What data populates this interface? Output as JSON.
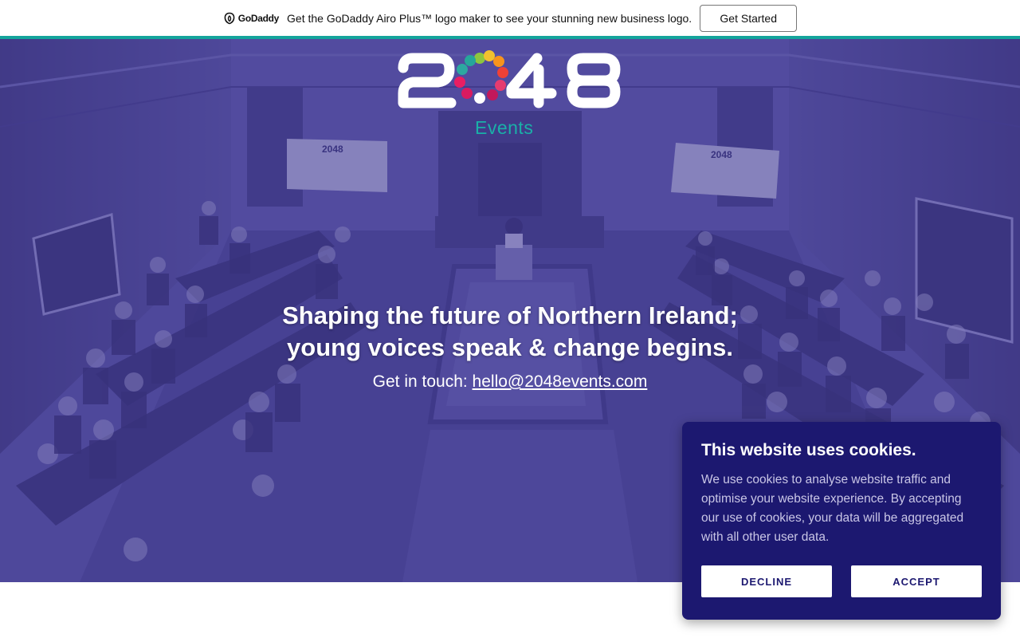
{
  "promo": {
    "brand": "GoDaddy",
    "message": "Get the GoDaddy Airo Plus™ logo maker to see your stunning new business logo.",
    "button_label": "Get Started"
  },
  "hero": {
    "logo": {
      "text": "2048",
      "subtext": "Events"
    },
    "headline_line1": "Shaping the future of Northern Ireland;",
    "headline_line2": "young voices speak & change begins.",
    "contact_prefix": "Get in touch: ",
    "contact_email": "hello@2048events.com",
    "background_description_icon": "chamber-photo"
  },
  "cookie": {
    "title": "This website uses cookies.",
    "body": "We use cookies to analyse website traffic and optimise your website experience. By accepting our use of cookies, your data will be aggregated with all other user data.",
    "decline_label": "DECLINE",
    "accept_label": "ACCEPT"
  },
  "colors": {
    "teal": "#14a49c",
    "hero_purple": "#4b4590",
    "cookie_bg": "#1c1870"
  }
}
